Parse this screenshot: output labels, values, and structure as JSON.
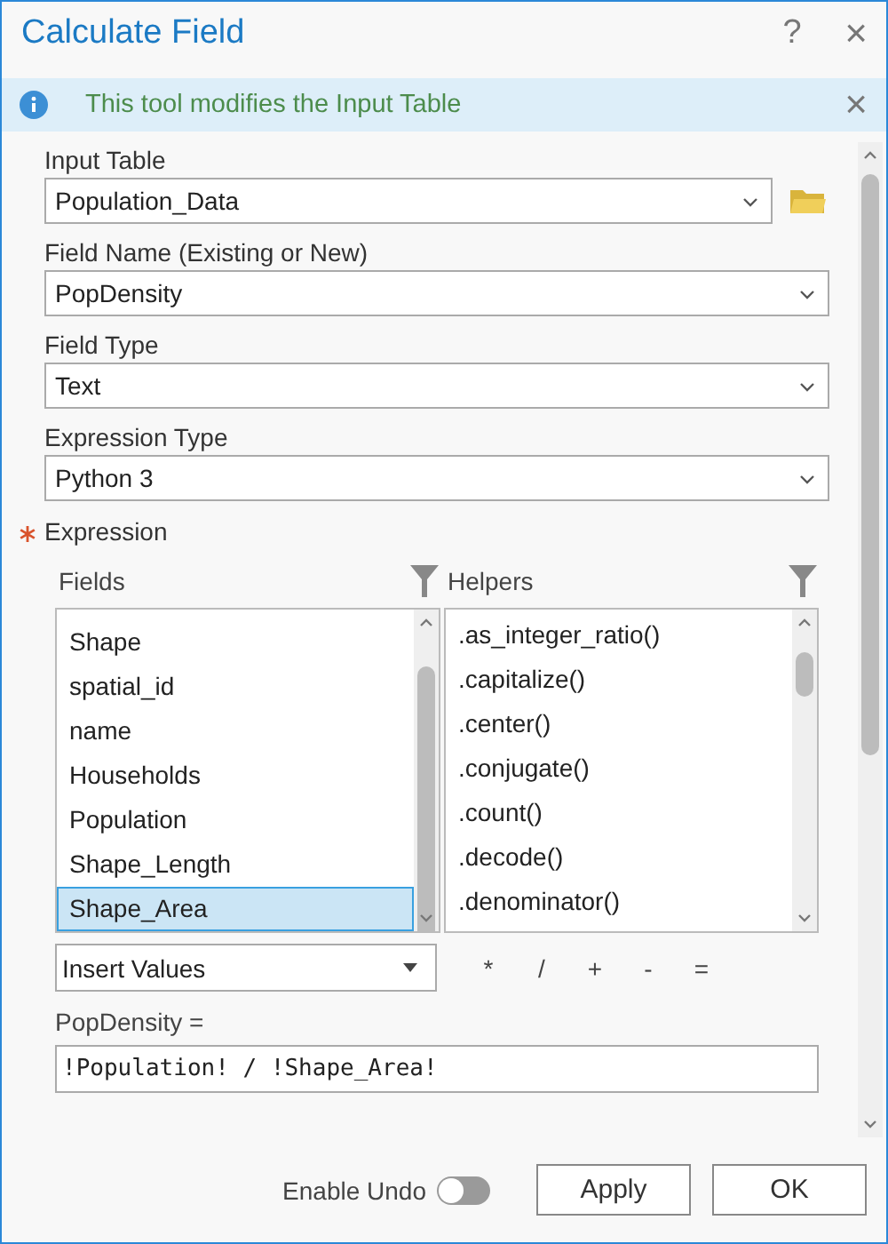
{
  "window": {
    "title": "Calculate Field",
    "help": "?",
    "close": "×"
  },
  "info_bar": {
    "message": "This tool modifies the Input Table",
    "close": "×"
  },
  "parameters": [
    {
      "kind": "dropdown",
      "label": "Input Table",
      "value": "Population_Data",
      "browse": true
    },
    {
      "kind": "dropdown",
      "label": "Field Name (Existing or New)",
      "value": "PopDensity"
    },
    {
      "kind": "dropdown",
      "label": "Field Type",
      "value": "Text"
    },
    {
      "kind": "dropdown",
      "label": "Expression Type",
      "value": "Python 3"
    }
  ],
  "expression": {
    "label": "Expression",
    "required": true,
    "fields": {
      "title": "Fields",
      "items": [
        {
          "label": "Shape",
          "selected": false
        },
        {
          "label": "spatial_id",
          "selected": false
        },
        {
          "label": "name",
          "selected": false
        },
        {
          "label": "Households",
          "selected": false
        },
        {
          "label": "Population",
          "selected": false
        },
        {
          "label": "Shape_Length",
          "selected": false
        },
        {
          "label": "Shape_Area",
          "selected": true
        }
      ]
    },
    "helpers": {
      "title": "Helpers",
      "items": [
        {
          "label": ".as_integer_ratio()",
          "selected": false
        },
        {
          "label": ".capitalize()",
          "selected": false
        },
        {
          "label": ".center()",
          "selected": false
        },
        {
          "label": ".conjugate()",
          "selected": false
        },
        {
          "label": ".count()",
          "selected": false
        },
        {
          "label": ".decode()",
          "selected": false
        },
        {
          "label": ".denominator()",
          "selected": false
        }
      ]
    },
    "insert": "Insert Values",
    "operators": [
      "*",
      "/",
      "+",
      "-",
      "="
    ],
    "target": "PopDensity =",
    "code": "!Population! / !Shape_Area!"
  },
  "footer": {
    "undo_label": "Enable Undo",
    "undo_on": false,
    "buttons": [
      "Apply",
      "OK"
    ]
  }
}
